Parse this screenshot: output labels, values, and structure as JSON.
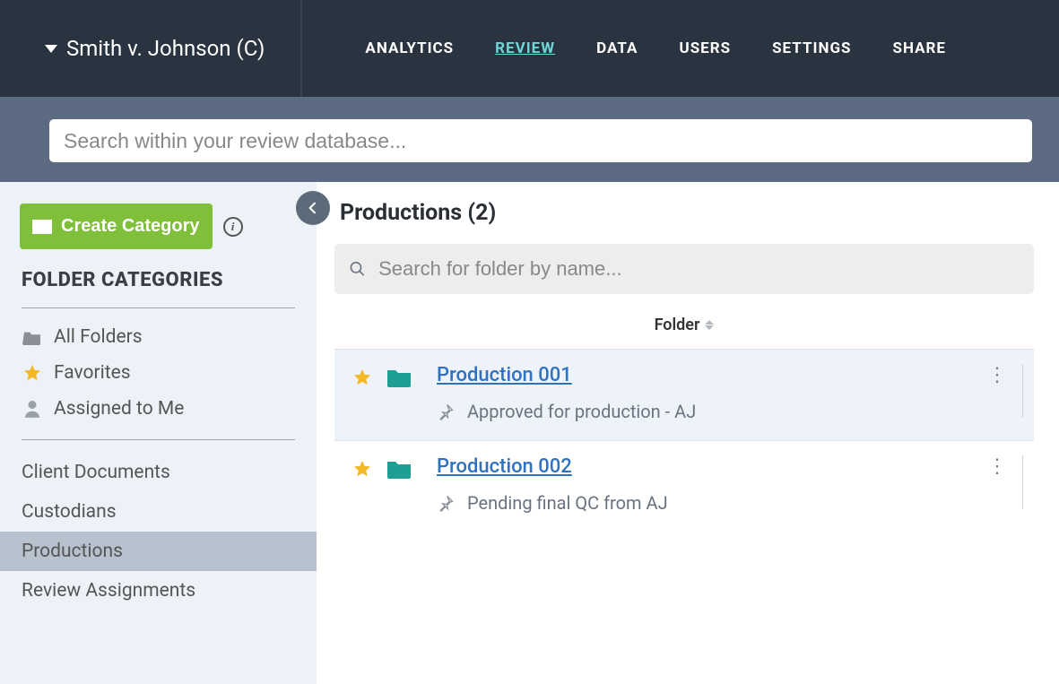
{
  "header": {
    "case_name": "Smith v. Johnson (C)",
    "nav": [
      {
        "label": "ANALYTICS",
        "active": false
      },
      {
        "label": "REVIEW",
        "active": true
      },
      {
        "label": "DATA",
        "active": false
      },
      {
        "label": "USERS",
        "active": false
      },
      {
        "label": "SETTINGS",
        "active": false
      },
      {
        "label": "SHARE",
        "active": false
      }
    ]
  },
  "search": {
    "placeholder": "Search within your review database..."
  },
  "sidebar": {
    "create_label": "Create Category",
    "heading": "FOLDER CATEGORIES",
    "fixed_items": [
      {
        "label": "All Folders",
        "icon": "folder"
      },
      {
        "label": "Favorites",
        "icon": "star"
      },
      {
        "label": "Assigned to Me",
        "icon": "person"
      }
    ],
    "categories": [
      {
        "label": "Client Documents",
        "active": false
      },
      {
        "label": "Custodians",
        "active": false
      },
      {
        "label": "Productions",
        "active": true
      },
      {
        "label": "Review Assignments",
        "active": false
      }
    ]
  },
  "main": {
    "title": "Productions (2)",
    "folder_search_placeholder": "Search for folder by name...",
    "column_header": "Folder",
    "rows": [
      {
        "name": "Production 001",
        "note": "Approved for production - AJ",
        "selected": true
      },
      {
        "name": "Production 002",
        "note": "Pending final QC from AJ",
        "selected": false
      }
    ]
  }
}
